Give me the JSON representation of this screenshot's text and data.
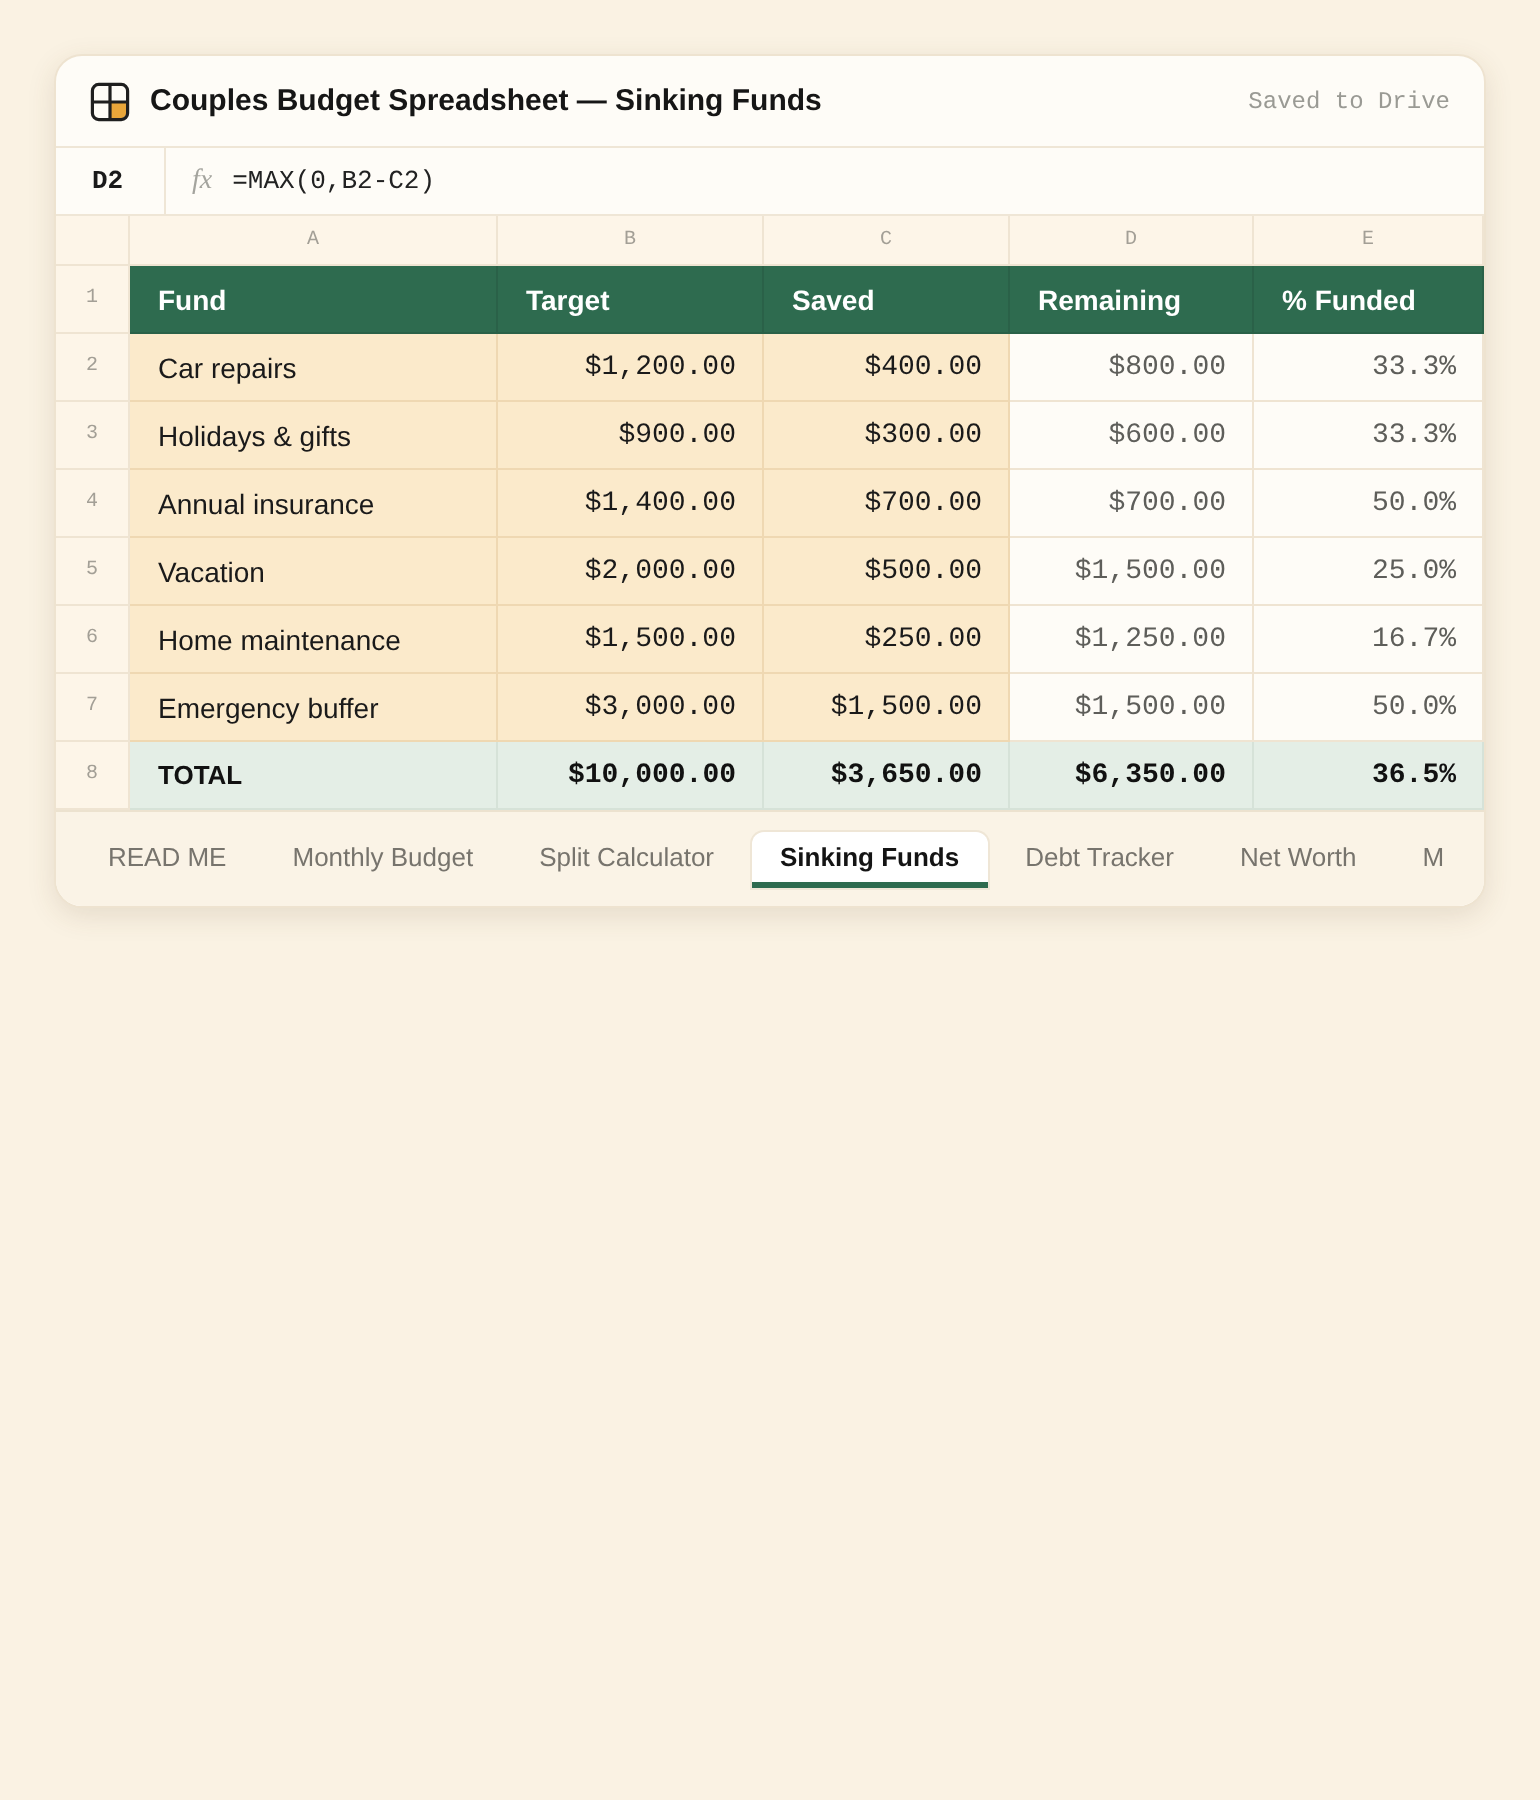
{
  "window": {
    "title": "Couples Budget Spreadsheet — Sinking Funds",
    "save_status": "Saved to Drive"
  },
  "formula_bar": {
    "cell_ref": "D2",
    "fx_label": "fx",
    "formula": "=MAX(0,B2-C2)"
  },
  "sheet": {
    "columns": [
      {
        "letter": "A",
        "kind": "label"
      },
      {
        "letter": "B",
        "kind": "input"
      },
      {
        "letter": "C",
        "kind": "input"
      },
      {
        "letter": "D",
        "kind": "formula"
      },
      {
        "letter": "E",
        "kind": "formula"
      }
    ],
    "rows": [
      {
        "number": "1",
        "kind": "header",
        "cells": [
          "Fund",
          "Target",
          "Saved",
          "Remaining",
          "% Funded"
        ]
      },
      {
        "number": "2",
        "kind": "data",
        "cells": [
          "Car repairs",
          "$1,200.00",
          "$400.00",
          "$800.00",
          "33.3%"
        ]
      },
      {
        "number": "3",
        "kind": "data",
        "cells": [
          "Holidays & gifts",
          "$900.00",
          "$300.00",
          "$600.00",
          "33.3%"
        ]
      },
      {
        "number": "4",
        "kind": "data",
        "cells": [
          "Annual insurance",
          "$1,400.00",
          "$700.00",
          "$700.00",
          "50.0%"
        ]
      },
      {
        "number": "5",
        "kind": "data",
        "cells": [
          "Vacation",
          "$2,000.00",
          "$500.00",
          "$1,500.00",
          "25.0%"
        ]
      },
      {
        "number": "6",
        "kind": "data",
        "cells": [
          "Home maintenance",
          "$1,500.00",
          "$250.00",
          "$1,250.00",
          "16.7%"
        ]
      },
      {
        "number": "7",
        "kind": "data",
        "cells": [
          "Emergency buffer",
          "$3,000.00",
          "$1,500.00",
          "$1,500.00",
          "50.0%"
        ]
      },
      {
        "number": "8",
        "kind": "total",
        "cells": [
          "TOTAL",
          "$10,000.00",
          "$3,650.00",
          "$6,350.00",
          "36.5%"
        ]
      }
    ]
  },
  "sheet_tabs": [
    {
      "label": "READ ME",
      "selected": false
    },
    {
      "label": "Monthly Budget",
      "selected": false
    },
    {
      "label": "Split Calculator",
      "selected": false
    },
    {
      "label": "Sinking Funds",
      "selected": true
    },
    {
      "label": "Debt Tracker",
      "selected": false
    },
    {
      "label": "Net Worth",
      "selected": false
    },
    {
      "label": "M",
      "selected": false
    }
  ]
}
